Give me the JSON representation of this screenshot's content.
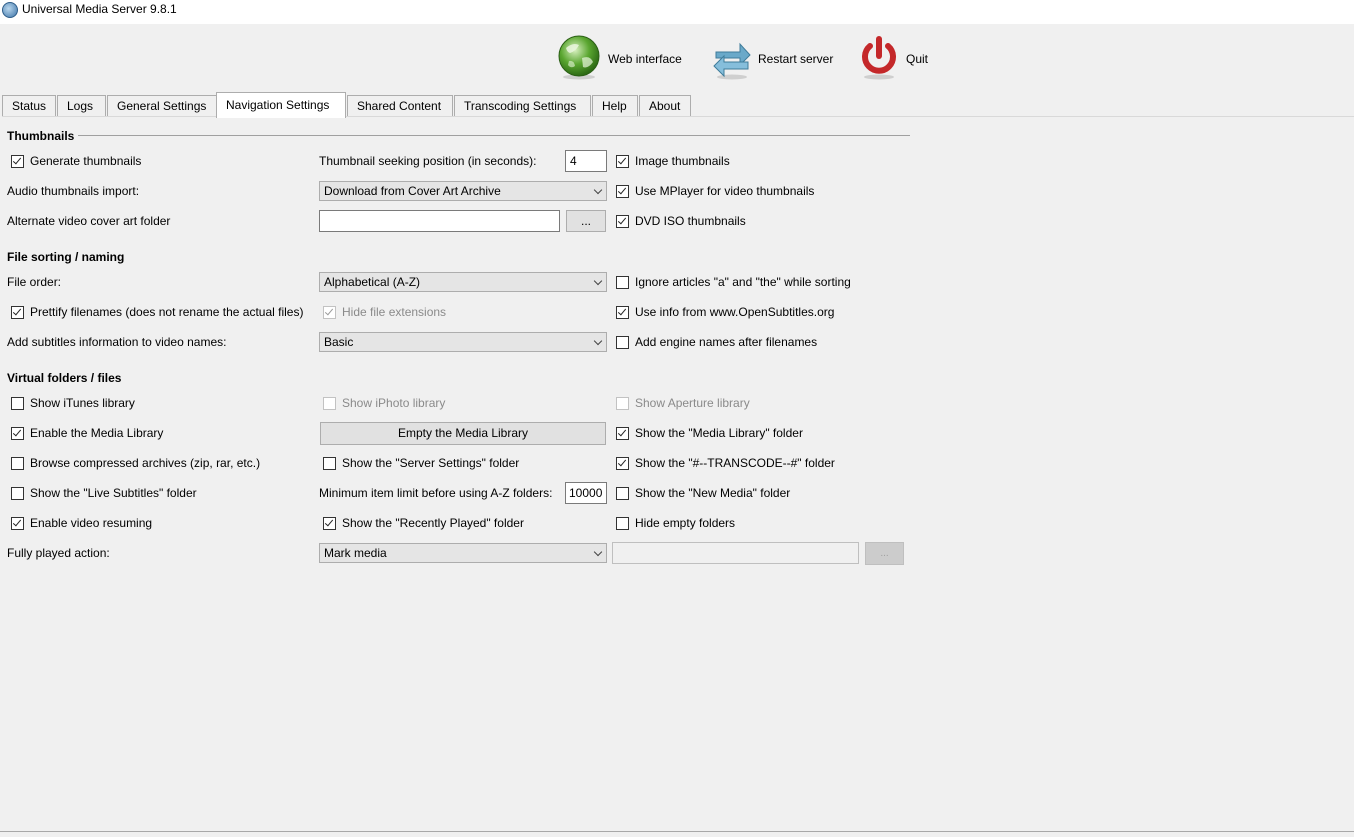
{
  "window": {
    "title": "Universal Media Server 9.8.1"
  },
  "toolbar": {
    "web_interface": "Web interface",
    "restart_server": "Restart server",
    "quit": "Quit"
  },
  "tabs": [
    "Status",
    "Logs",
    "General Settings",
    "Navigation Settings",
    "Shared Content",
    "Transcoding Settings",
    "Help",
    "About"
  ],
  "active_tab": "Navigation Settings",
  "thumbnails": {
    "title": "Thumbnails",
    "generate_thumbnails": "Generate thumbnails",
    "seek_label": "Thumbnail seeking position (in seconds):",
    "seek_value": "4",
    "image_thumbnails": "Image thumbnails",
    "audio_import_label": "Audio thumbnails import:",
    "audio_import_value": "Download from Cover Art Archive",
    "use_mplayer": "Use MPlayer for video thumbnails",
    "alt_cover_label": "Alternate video cover art folder",
    "alt_cover_value": "",
    "browse": "...",
    "dvd_iso": "DVD ISO thumbnails"
  },
  "sorting": {
    "title": "File sorting / naming",
    "file_order_label": "File order:",
    "file_order_value": "Alphabetical (A-Z)",
    "ignore_articles": "Ignore articles \"a\" and \"the\" while sorting",
    "prettify": "Prettify filenames (does not rename the actual files)",
    "hide_ext": "Hide file extensions",
    "opensubtitles": "Use info from www.OpenSubtitles.org",
    "subs_info_label": "Add subtitles information to video names:",
    "subs_info_value": "Basic",
    "engine_names": "Add engine names after filenames"
  },
  "virtual": {
    "title": "Virtual folders / files",
    "itunes": "Show iTunes library",
    "iphoto": "Show iPhoto library",
    "aperture": "Show Aperture library",
    "media_library": "Enable the Media Library",
    "empty_library": "Empty the Media Library",
    "show_media_library": "Show the \"Media Library\" folder",
    "compressed": "Browse compressed archives (zip, rar, etc.)",
    "server_settings": "Show the \"Server Settings\" folder",
    "transcode": "Show the \"#--TRANSCODE--#\" folder",
    "live_subs": "Show the \"Live Subtitles\" folder",
    "az_label": "Minimum item limit before using A-Z folders:",
    "az_value": "10000",
    "new_media": "Show the \"New Media\" folder",
    "resume": "Enable video resuming",
    "recently_played": "Show the \"Recently Played\" folder",
    "hide_empty": "Hide empty folders",
    "fully_played_label": "Fully played action:",
    "fully_played_value": "Mark media",
    "fully_played_path": "",
    "fully_played_browse": "..."
  }
}
